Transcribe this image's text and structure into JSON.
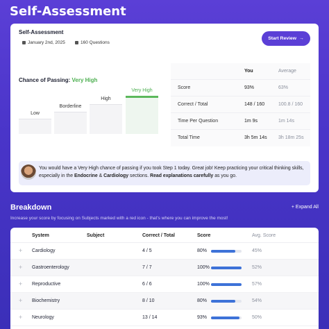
{
  "page": {
    "title": "Self-Assessment"
  },
  "card": {
    "title": "Self-Assessment",
    "date": "January 2nd, 2025",
    "questions": "160 Questions",
    "start_button": "Start Review",
    "start_arrow": "→",
    "passing_prefix": "Chance of Passing:",
    "passing_value": "Very High",
    "levels": [
      {
        "label": "Low",
        "active": false
      },
      {
        "label": "Borderline",
        "active": false
      },
      {
        "label": "High",
        "active": false
      },
      {
        "label": "Very High",
        "active": true
      }
    ],
    "stats": {
      "headers": [
        "",
        "You",
        "Average"
      ],
      "rows": [
        {
          "label": "Score",
          "you": "93%",
          "avg": "63%"
        },
        {
          "label": "Correct / Total",
          "you": "148 / 160",
          "avg": "100.8 / 160"
        },
        {
          "label": "Time Per Question",
          "you": "1m 9s",
          "avg": "1m 14s"
        },
        {
          "label": "Total Time",
          "you": "3h 5m 14s",
          "avg": "3h 18m 25s"
        }
      ]
    },
    "tip": {
      "t1": "You would have a Very High chance of passing if you took Step 1 today. Great job! Keep practicing your critical thinking skills, especially in the ",
      "b1": "Endocrine",
      "t2": " & ",
      "b2": "Cardiology",
      "t3": " sections. ",
      "b3": "Read explanations carefully",
      "t4": " as you go."
    }
  },
  "breakdown": {
    "title": "Breakdown",
    "expand_label": "+ Expand All",
    "subtitle": "Increase your score by focusing on Subjects marked with a red icon - that's where you can improve the most!",
    "columns": [
      "System",
      "Subject",
      "Correct / Total",
      "Score",
      "Avg. Score"
    ],
    "rows": [
      {
        "system": "Cardiology",
        "subject": "",
        "correct": "4 / 5",
        "score": "80%",
        "score_value": 0.8,
        "avg": "45%"
      },
      {
        "system": "Gastroenterology",
        "subject": "",
        "correct": "7 / 7",
        "score": "100%",
        "score_value": 1.0,
        "avg": "52%"
      },
      {
        "system": "Reproductive",
        "subject": "",
        "correct": "6 / 6",
        "score": "100%",
        "score_value": 1.0,
        "avg": "57%"
      },
      {
        "system": "Biochemistry",
        "subject": "",
        "correct": "8 / 10",
        "score": "80%",
        "score_value": 0.8,
        "avg": "54%"
      },
      {
        "system": "Neurology",
        "subject": "",
        "correct": "13 / 14",
        "score": "93%",
        "score_value": 0.93,
        "avg": "50%"
      }
    ]
  },
  "colors": {
    "accent": "#5b3fd6",
    "success": "#4caf50",
    "bar": "#3d72d8"
  }
}
